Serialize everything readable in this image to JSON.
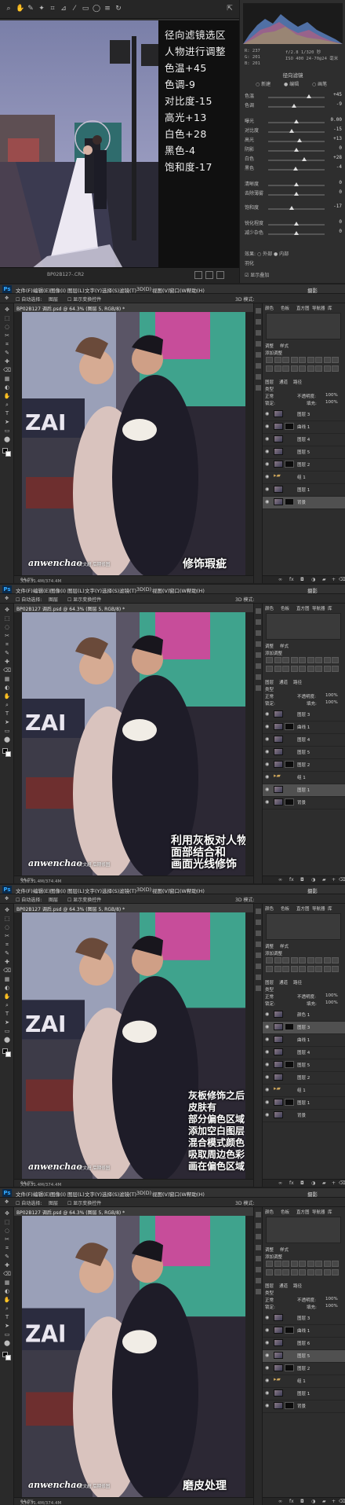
{
  "camera_raw": {
    "histogram_readout": [
      "R: 237",
      "G: 201",
      "B: 201"
    ],
    "camera_info": [
      "f/2.8  1/320 秒",
      "ISO 400  24-70@24 毫米"
    ],
    "section_title": "径向滤镜",
    "modes": [
      "新建",
      "编辑",
      "画笔"
    ],
    "selected_mode": "编辑",
    "sliders": [
      {
        "label": "色温",
        "value": "+45",
        "pos": 0.72
      },
      {
        "label": "色调",
        "value": "-9",
        "pos": 0.46
      },
      {
        "label": "曝光",
        "value": "0.00",
        "pos": 0.5
      },
      {
        "label": "对比度",
        "value": "-15",
        "pos": 0.42
      },
      {
        "label": "高光",
        "value": "+13",
        "pos": 0.56
      },
      {
        "label": "阴影",
        "value": "0",
        "pos": 0.5
      },
      {
        "label": "白色",
        "value": "+28",
        "pos": 0.64
      },
      {
        "label": "黑色",
        "value": "-4",
        "pos": 0.48
      },
      {
        "label": "清晰度",
        "value": "0",
        "pos": 0.5
      },
      {
        "label": "去除薄雾",
        "value": "0",
        "pos": 0.5
      },
      {
        "label": "饱和度",
        "value": "-17",
        "pos": 0.41
      },
      {
        "label": "锐化程度",
        "value": "0",
        "pos": 0.5
      },
      {
        "label": "减少杂色",
        "value": "0",
        "pos": 0.5
      }
    ],
    "footer_labels": [
      "效果",
      "外部",
      "内部",
      "羽化",
      "显示叠加"
    ],
    "annotation": [
      "径向滤镜选区",
      "人物进行调整",
      "色温+45",
      "色调-9",
      "对比度-15",
      "高光+13",
      "白色+28",
      "黑色-4",
      "饱和度-17"
    ],
    "bottom_filename": "BP02B127-.CR2",
    "accent": "#4d90fe"
  },
  "photoshop": {
    "menu": [
      "文件(F)",
      "编辑(E)",
      "图像(I)",
      "图层(L)",
      "文字(Y)",
      "选择(S)",
      "滤镜(T)",
      "3D(D)",
      "视图(V)",
      "窗口(W)",
      "帮助(H)"
    ],
    "options": [
      "自动选择:",
      "图层",
      "显示变换控件"
    ],
    "mode_3d": "3D 模式:",
    "workspace": "摄影",
    "doc_tab": "BP02B127 调后.psd @ 64.3% (图层 5, RGB/8) *",
    "zoom_status": "64.3%",
    "doc_status": "文档:31.4M/374.4M",
    "right_tabs": [
      "颜色",
      "色板",
      "直方图",
      "导航器",
      "库"
    ],
    "adjust_tabs": [
      "调整",
      "样式"
    ],
    "adjust_title": "添加调整",
    "layers_tabs": [
      "图层",
      "通道",
      "路径"
    ],
    "blend_mode": "正常",
    "opacity_label": "不透明度:",
    "opacity_value": "100%",
    "fill_label": "填充:",
    "fill_value": "100%",
    "lock_label": "锁定:",
    "kind_label": "类型"
  },
  "panels": [
    {
      "caption": [
        "修饰瑕疵"
      ],
      "layers": [
        "图层 3",
        "曲线 1",
        "图层 4",
        "图层 5",
        "图层 2",
        "组 1",
        "图层 1",
        "背景"
      ],
      "selected_layer": 7
    },
    {
      "caption": [
        "利用灰板对人物",
        "面部结合和",
        "画面光线修饰"
      ],
      "layers": [
        "图层 3",
        "曲线 1",
        "图层 4",
        "图层 5",
        "图层 2",
        "组 1",
        "图层 1",
        "背景"
      ],
      "selected_layer": 6
    },
    {
      "caption": [
        "灰板修饰之后",
        "皮肤有",
        "部分偏色区域",
        "添加空白图层",
        "混合模式颜色",
        "吸取周边色彩",
        "画在偏色区域"
      ],
      "layers": [
        "颜色 1",
        "图层 3",
        "曲线 1",
        "图层 4",
        "图层 5",
        "图层 2",
        "组 1",
        "图层 1",
        "背景"
      ],
      "selected_layer": 1
    },
    {
      "caption": [
        "磨皮处理"
      ],
      "layers": [
        "图层 3",
        "曲线 1",
        "图层 6",
        "图层 5",
        "图层 2",
        "组 1",
        "图层 1",
        "背景"
      ],
      "selected_layer": 3
    }
  ],
  "watermark": {
    "signature": "anwenchao",
    "studio": "安文超 后期修图"
  }
}
